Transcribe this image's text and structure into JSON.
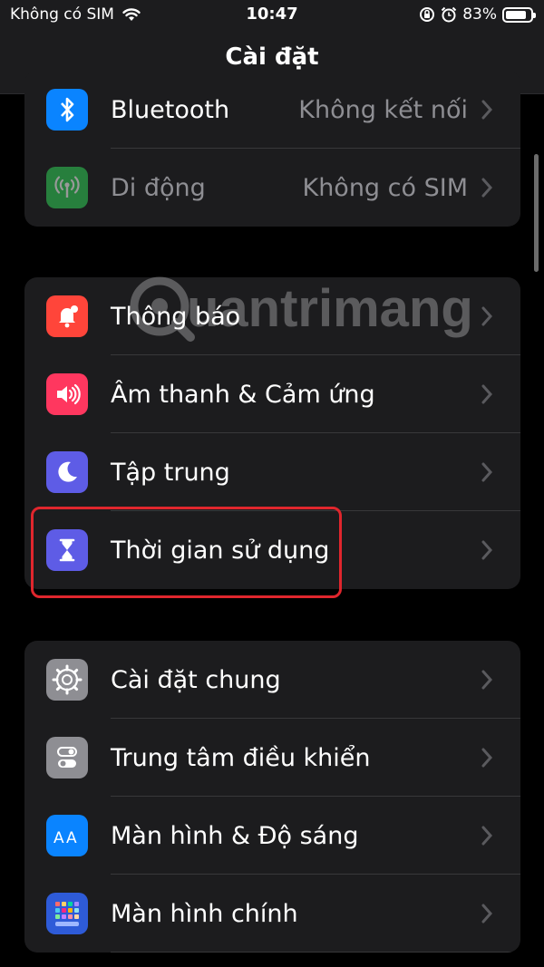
{
  "status": {
    "carrier": "Không có SIM",
    "time": "10:47",
    "battery": "83%",
    "battery_level": 0.83
  },
  "nav": {
    "title": "Cài đặt"
  },
  "groups": [
    {
      "rows": [
        {
          "label": "Bluetooth",
          "value": "Không kết nối",
          "icon": "bluetooth-icon",
          "color": "#0a84ff"
        },
        {
          "label": "Di động",
          "value": "Không có SIM",
          "icon": "antenna-icon",
          "color": "#30d158"
        }
      ]
    },
    {
      "rows": [
        {
          "label": "Thông báo",
          "icon": "bell-icon",
          "color": "#ff453a"
        },
        {
          "label": "Âm thanh & Cảm ứng",
          "icon": "speaker-icon",
          "color": "#ff375f"
        },
        {
          "label": "Tập trung",
          "icon": "moon-icon",
          "color": "#5e5ce6"
        },
        {
          "label": "Thời gian sử dụng",
          "icon": "hourglass-icon",
          "color": "#5e5ce6"
        }
      ]
    },
    {
      "rows": [
        {
          "label": "Cài đặt chung",
          "icon": "gear-icon",
          "color": "#8e8e93"
        },
        {
          "label": "Trung tâm điều khiển",
          "icon": "toggles-icon",
          "color": "#8e8e93"
        },
        {
          "label": "Màn hình & Độ sáng",
          "icon": "text-size-icon",
          "color": "#0a84ff"
        },
        {
          "label": "Màn hình chính",
          "icon": "home-grid-icon",
          "color": "#0a60ff"
        }
      ]
    }
  ],
  "watermark": {
    "text": "uantrimang"
  }
}
